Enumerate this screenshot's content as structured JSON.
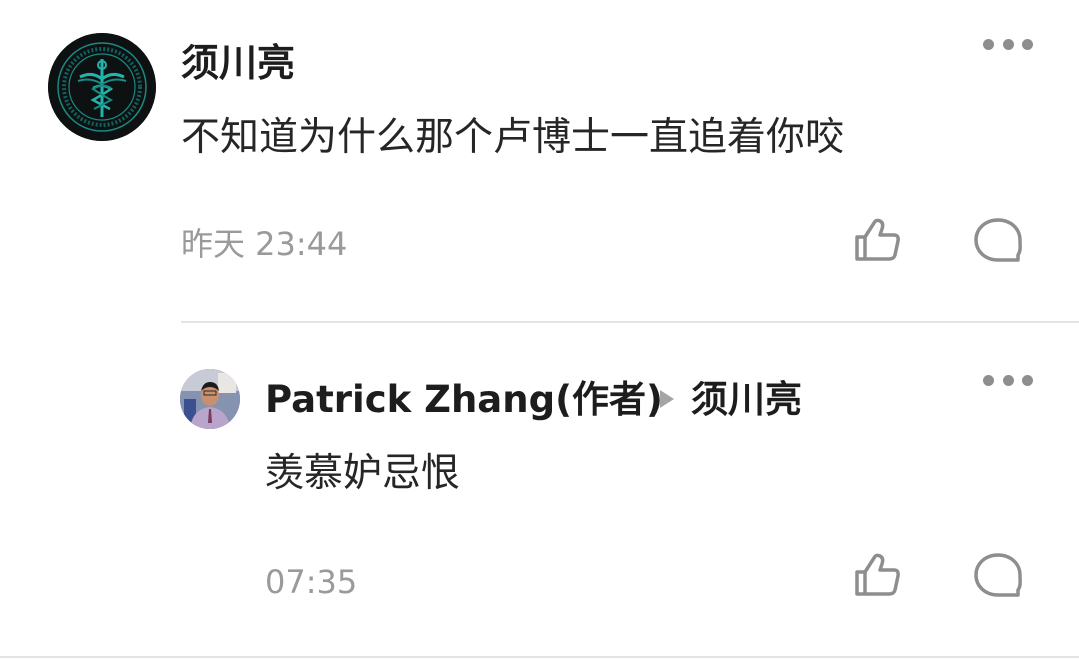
{
  "comments": [
    {
      "author": "须川亮",
      "text": "不知道为什么那个卢博士一直追着你咬",
      "time": "昨天 23:44",
      "avatar_icon": "caduceus-emblem-avatar",
      "replies": [
        {
          "author": "Patrick Zhang(作者)",
          "reply_to": "须川亮",
          "text": "羡慕妒忌恨",
          "time": "07:35",
          "avatar_icon": "person-photo-avatar"
        }
      ]
    }
  ],
  "icons": {
    "more": "more-dots-icon",
    "like": "thumbs-up-icon",
    "reply": "comment-bubble-icon",
    "reply_to": "triangle-right-icon"
  },
  "colors": {
    "name": "#1d1d1d",
    "text": "#262626",
    "meta": "#9a9a9a",
    "icon": "#8e8e8e",
    "divider": "#e4e4e4"
  }
}
